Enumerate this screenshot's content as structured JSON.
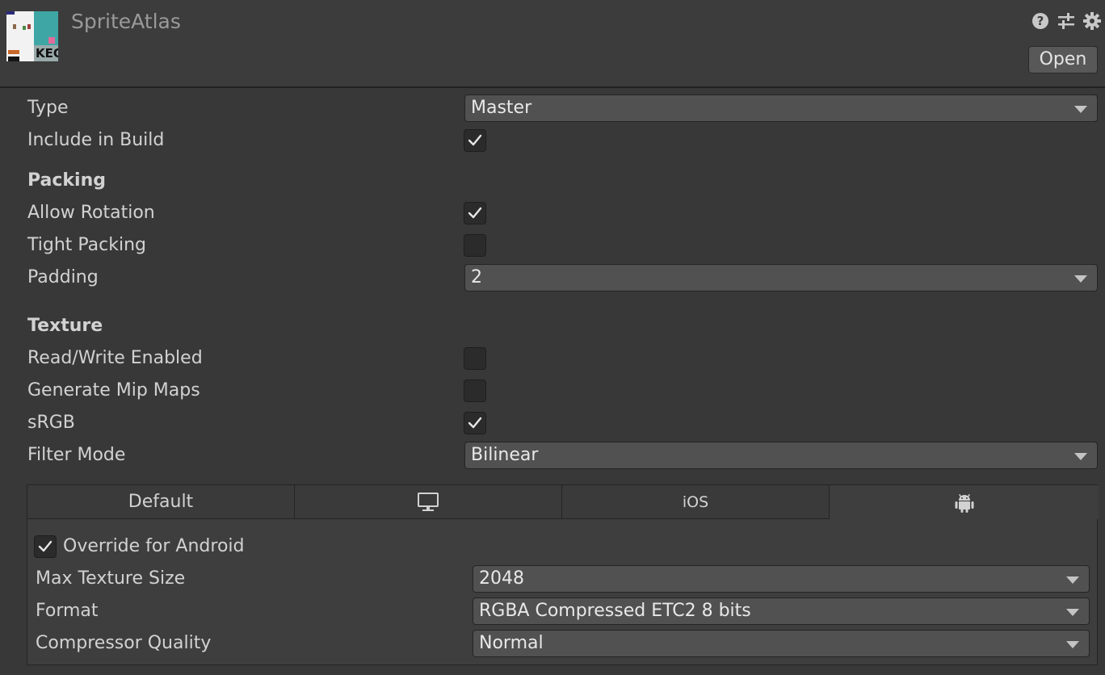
{
  "header": {
    "title": "SpriteAtlas",
    "thumbnail_text": "KEO",
    "icons": [
      "help-icon",
      "preset-sliders-icon",
      "settings-gear-icon"
    ],
    "open_label": "Open"
  },
  "fields": {
    "type": {
      "label": "Type",
      "value": "Master"
    },
    "include_in_build": {
      "label": "Include in Build",
      "checked": true
    },
    "packing_header": "Packing",
    "allow_rotation": {
      "label": "Allow Rotation",
      "checked": true
    },
    "tight_packing": {
      "label": "Tight Packing",
      "checked": false
    },
    "padding": {
      "label": "Padding",
      "value": "2"
    },
    "texture_header": "Texture",
    "read_write": {
      "label": "Read/Write Enabled",
      "checked": false
    },
    "mip_maps": {
      "label": "Generate Mip Maps",
      "checked": false
    },
    "srgb": {
      "label": "sRGB",
      "checked": true
    },
    "filter_mode": {
      "label": "Filter Mode",
      "value": "Bilinear"
    }
  },
  "platform_tabs": {
    "default_label": "Default",
    "standalone_icon": "monitor-icon",
    "ios_label": "iOS",
    "android_icon": "android-icon",
    "active": "android"
  },
  "android": {
    "override": {
      "label": "Override for Android",
      "checked": true
    },
    "max_texture_size": {
      "label": "Max Texture Size",
      "value": "2048"
    },
    "format": {
      "label": "Format",
      "value": "RGBA Compressed ETC2 8 bits"
    },
    "compressor_quality": {
      "label": "Compressor Quality",
      "value": "Normal"
    }
  },
  "colors": {
    "background": "#383838",
    "header": "#3c3c3c",
    "field": "#515151",
    "checkbox": "#2b2b2b",
    "text": "#d2d2d2"
  }
}
